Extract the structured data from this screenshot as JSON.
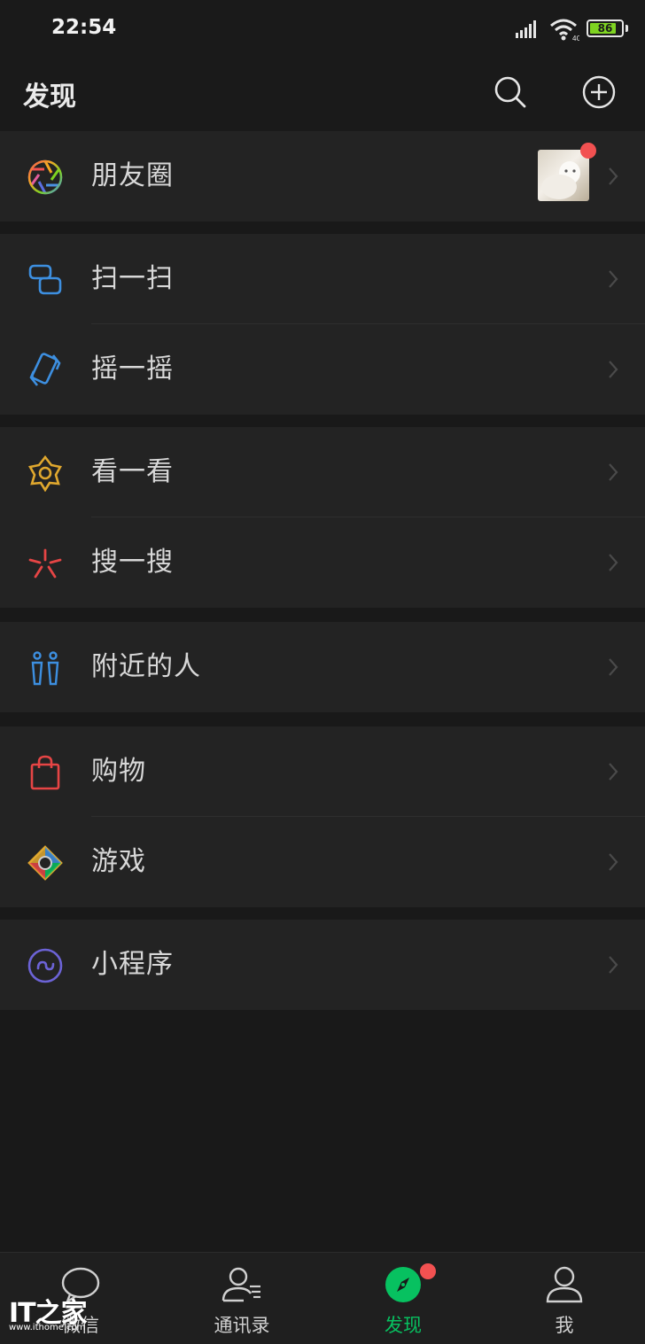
{
  "status_bar": {
    "time": "22:54",
    "battery_level": 86,
    "battery_text": "86"
  },
  "header": {
    "title": "发现"
  },
  "groups": [
    {
      "items": [
        {
          "label": "朋友圈",
          "icon": "moments-aperture-icon",
          "has_thumbnail": true,
          "unread_dot": true
        }
      ]
    },
    {
      "items": [
        {
          "label": "扫一扫",
          "icon": "scan-icon"
        },
        {
          "label": "摇一摇",
          "icon": "shake-icon"
        }
      ]
    },
    {
      "items": [
        {
          "label": "看一看",
          "icon": "top-stories-icon"
        },
        {
          "label": "搜一搜",
          "icon": "search-spark-icon"
        }
      ]
    },
    {
      "items": [
        {
          "label": "附近的人",
          "icon": "people-nearby-icon"
        }
      ]
    },
    {
      "items": [
        {
          "label": "购物",
          "icon": "shopping-bag-icon"
        },
        {
          "label": "游戏",
          "icon": "games-icon"
        }
      ]
    },
    {
      "items": [
        {
          "label": "小程序",
          "icon": "mini-programs-icon"
        }
      ]
    }
  ],
  "tabs": [
    {
      "label": "微信",
      "icon": "chat-bubble-icon",
      "active": false
    },
    {
      "label": "通讯录",
      "icon": "contacts-icon",
      "active": false
    },
    {
      "label": "发现",
      "icon": "compass-icon",
      "active": true,
      "badge_dot": true
    },
    {
      "label": "我",
      "icon": "person-icon",
      "active": false
    }
  ],
  "watermark": {
    "logo": "IT之家",
    "url": "www.ithome.com"
  },
  "colors": {
    "background": "#191919",
    "cell": "#232323",
    "accent": "#07c160",
    "badge": "#f25151"
  }
}
